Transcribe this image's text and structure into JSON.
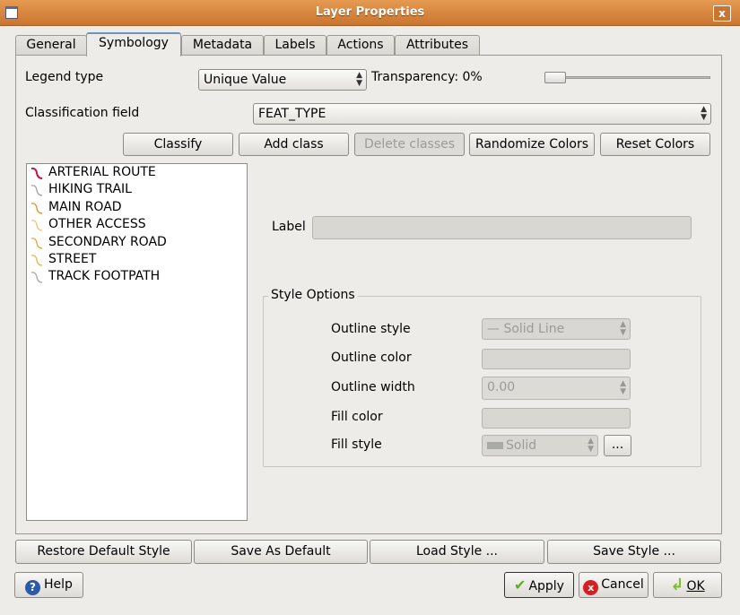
{
  "window": {
    "title": "Layer Properties",
    "close_label": "x"
  },
  "tabs": [
    {
      "label": "General"
    },
    {
      "label": "Symbology"
    },
    {
      "label": "Metadata"
    },
    {
      "label": "Labels"
    },
    {
      "label": "Actions"
    },
    {
      "label": "Attributes"
    }
  ],
  "symbology": {
    "legend_type_label": "Legend type",
    "legend_type_value": "Unique Value",
    "transparency_label": "Transparency: 0%",
    "transparency_percent": 0,
    "classification_field_label": "Classification field",
    "classification_field_value": "FEAT_TYPE",
    "buttons": {
      "classify": "Classify",
      "add_class": "Add class",
      "delete_classes": "Delete classes",
      "randomize_colors": "Randomize Colors",
      "reset_colors": "Reset Colors"
    },
    "classes": [
      {
        "label": "ARTERIAL ROUTE",
        "color": "#d0103a"
      },
      {
        "label": "HIKING TRAIL",
        "color": "#a0a0a0"
      },
      {
        "label": "MAIN ROAD",
        "color": "#e0901a"
      },
      {
        "label": "OTHER ACCESS",
        "color": "#f0c080"
      },
      {
        "label": "SECONDARY ROAD",
        "color": "#e8a040"
      },
      {
        "label": "STREET",
        "color": "#f0b040"
      },
      {
        "label": "TRACK FOOTPATH",
        "color": "#a8a8a8"
      }
    ],
    "label_label": "Label",
    "label_value": "",
    "style_options": {
      "title": "Style Options",
      "outline_style_label": "Outline style",
      "outline_style_value": "— Solid Line",
      "outline_color_label": "Outline color",
      "outline_width_label": "Outline width",
      "outline_width_value": "0.00",
      "fill_color_label": "Fill color",
      "fill_style_label": "Fill style",
      "fill_style_value": "Solid",
      "more_label": "..."
    }
  },
  "style_buttons": {
    "restore": "Restore Default Style",
    "save_default": "Save As Default",
    "load": "Load Style ...",
    "save": "Save Style ..."
  },
  "dialog_buttons": {
    "help": "Help",
    "apply": "Apply",
    "cancel": "Cancel",
    "ok": "OK"
  },
  "colors": {
    "titlebar": "#d9873f",
    "active_tab": "#6f95bf"
  }
}
